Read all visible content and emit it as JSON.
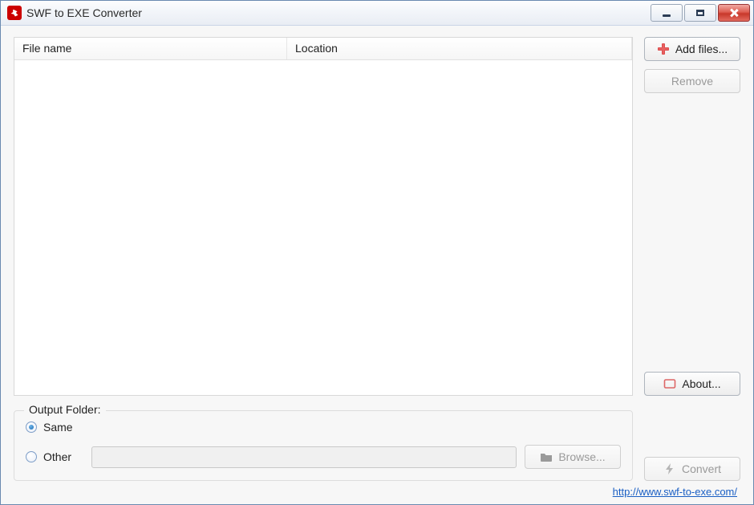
{
  "titlebar": {
    "title": "SWF to EXE Converter"
  },
  "table": {
    "columns": {
      "filename": "File name",
      "location": "Location"
    }
  },
  "buttons": {
    "add_files": "Add files...",
    "remove": "Remove",
    "about": "About...",
    "browse": "Browse...",
    "convert": "Convert"
  },
  "output": {
    "legend": "Output Folder:",
    "same": "Same",
    "other": "Other",
    "path": ""
  },
  "footer": {
    "link": "http://www.swf-to-exe.com/"
  }
}
